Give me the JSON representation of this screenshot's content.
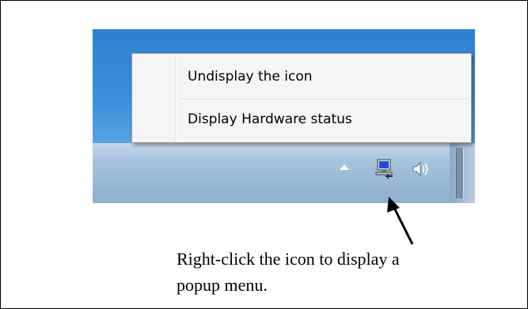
{
  "context_menu": {
    "items": [
      {
        "label": "Undisplay the icon"
      },
      {
        "label": "Display Hardware status"
      }
    ]
  },
  "tray": {
    "icons": [
      "show-hidden-icons-arrow",
      "hardware-status-computer-icon",
      "volume-speaker-icon"
    ]
  },
  "annotation": {
    "line1": "Right-click the icon to display a",
    "line2": "popup menu."
  }
}
